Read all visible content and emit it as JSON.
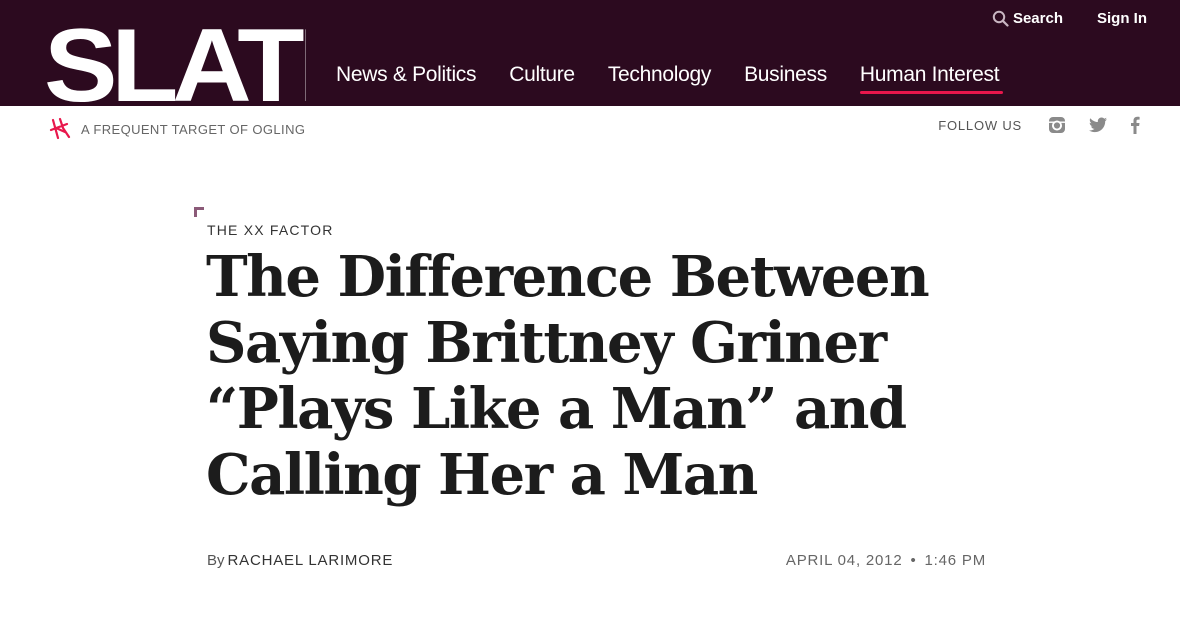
{
  "header": {
    "logo": "SLATE",
    "util": {
      "search_label": "Search",
      "signin_label": "Sign In"
    },
    "nav": [
      {
        "label": "News & Politics"
      },
      {
        "label": "Culture"
      },
      {
        "label": "Technology"
      },
      {
        "label": "Business"
      },
      {
        "label": "Human Interest"
      }
    ],
    "active_nav": "Human Interest",
    "bg_color": "#2c0a1f",
    "accent_color": "#e8174c"
  },
  "subbar": {
    "tagline": "A FREQUENT TARGET OF OGLING",
    "follow_label": "FOLLOW US",
    "social_icons": [
      "instagram-icon",
      "twitter-icon",
      "facebook-icon"
    ]
  },
  "article": {
    "kicker": "THE XX FACTOR",
    "headline_lines": [
      "The Difference Between",
      "Saying Brittney Griner",
      "“Plays Like a Man” and",
      "Calling Her a Man"
    ],
    "by_label": "By",
    "author": "RACHAEL LARIMORE",
    "date": "APRIL 04, 2012",
    "separator": "•",
    "time": "1:46 PM"
  }
}
